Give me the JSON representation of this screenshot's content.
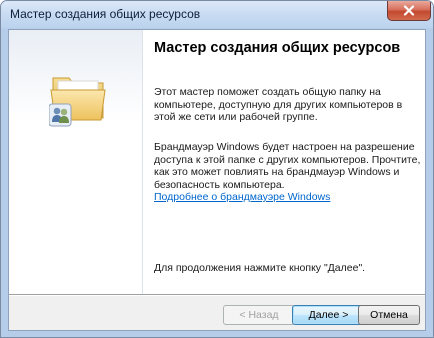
{
  "window": {
    "title": "Мастер создания общих ресурсов"
  },
  "wizard": {
    "heading": "Мастер создания общих ресурсов",
    "paragraph1": "Этот мастер поможет создать общую папку на компьютере, доступную для других компьютеров в этой же сети или рабочей группе.",
    "paragraph2": "Брандмауэр Windows будет настроен на разрешение доступа к этой папке с других компьютеров. Прочтите, как это может повлиять на брандмауэр Windows и безопасность компьютера.",
    "link": "Подробнее о брандмауэре Windows",
    "footer": "Для продолжения нажмите кнопку \"Далее\"."
  },
  "buttons": {
    "back": "< Назад",
    "next": "Далее >",
    "cancel": "Отмена"
  },
  "icons": {
    "folder": "shared-folder-users-icon",
    "close": "close-icon"
  },
  "colors": {
    "link": "#0066cc",
    "close_button": "#c24a2f",
    "titlebar": "#c5d9f1"
  }
}
